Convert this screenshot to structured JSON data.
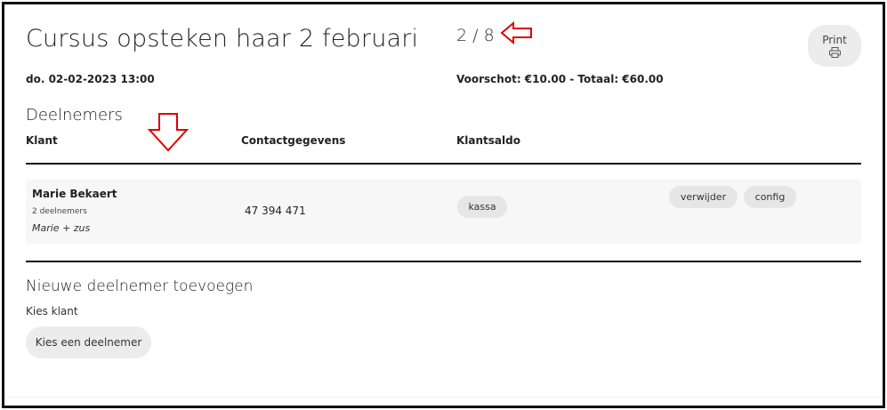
{
  "header": {
    "title": "Cursus opsteken haar 2 februari",
    "counter": "2 / 8",
    "print_label": "Print",
    "date": "do. 02-02-2023 13:00",
    "deposit_total": "Voorschot: €10.00 - Totaal: €60.00"
  },
  "participants": {
    "heading": "Deelnemers",
    "columns": [
      "Klant",
      "Contactgegevens",
      "Klantsaldo"
    ],
    "rows": [
      {
        "name": "Marie Bekaert",
        "count": "2 deelnemers",
        "note": "Marie + zus",
        "phone": "47 394 471",
        "balance_button": "kassa",
        "remove_button": "verwijder",
        "config_button": "config"
      }
    ]
  },
  "add_participant": {
    "heading": "Nieuwe deelnemer toevoegen",
    "label": "Kies klant",
    "button": "Kies een deelnemer"
  },
  "annotations": {
    "arrow_color": "#e00000",
    "icons": [
      "arrow-left-icon",
      "arrow-down-icon"
    ]
  }
}
